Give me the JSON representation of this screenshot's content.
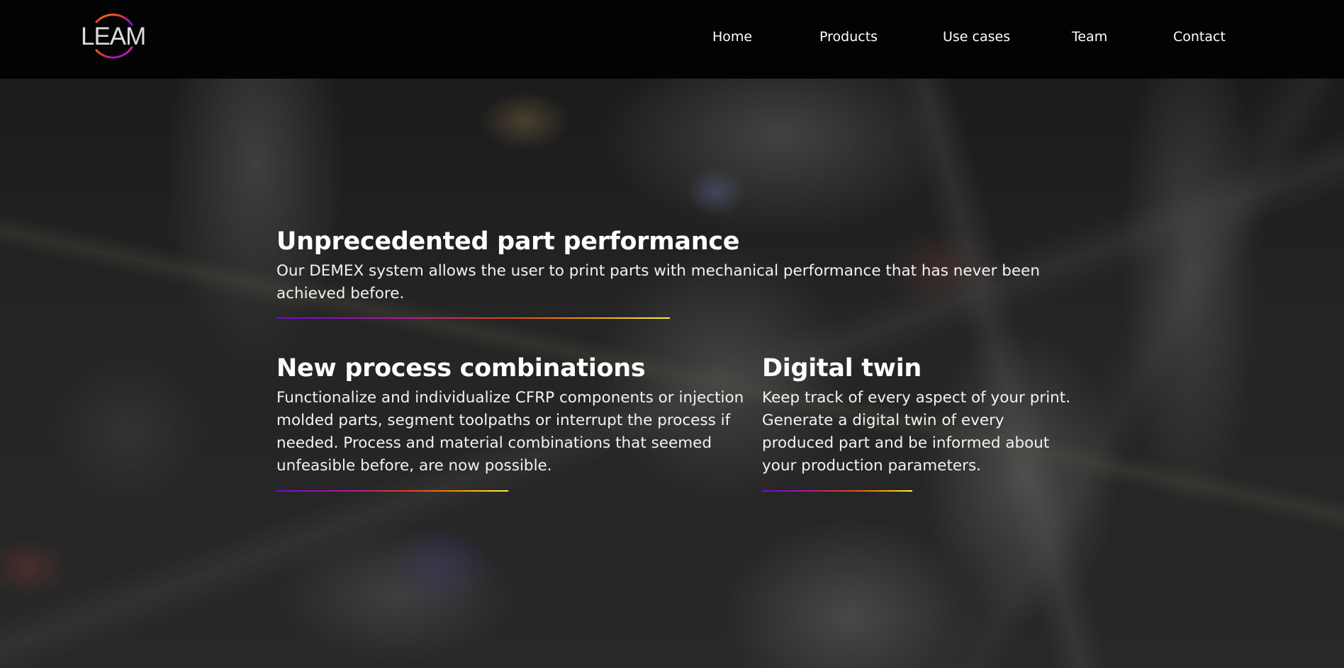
{
  "header": {
    "logo_text": "LEAM",
    "nav": [
      {
        "label": "Home"
      },
      {
        "label": "Products"
      },
      {
        "label": "Use cases"
      },
      {
        "label": "Team"
      },
      {
        "label": "Contact"
      }
    ]
  },
  "sections": {
    "performance": {
      "title": "Unprecedented part performance",
      "body": "Our DEMEX system allows the user to print parts with mechanical performance that has never been achieved before."
    },
    "process": {
      "title": "New process combinations",
      "body": "Functionalize and individualize CFRP components or injection molded parts, segment toolpaths or interrupt the process if needed. Process and material combinations that seemed unfeasible before, are now possible."
    },
    "twin": {
      "title": "Digital twin",
      "body": "Keep track of every aspect of your print. Generate a digital twin of every produced part and be informed about your production parameters."
    }
  },
  "colors": {
    "header_bg": "#030303",
    "accent_gradient": [
      "#6a0fd6",
      "#b0149e",
      "#e0461e",
      "#f0a000",
      "#fff13a"
    ]
  }
}
